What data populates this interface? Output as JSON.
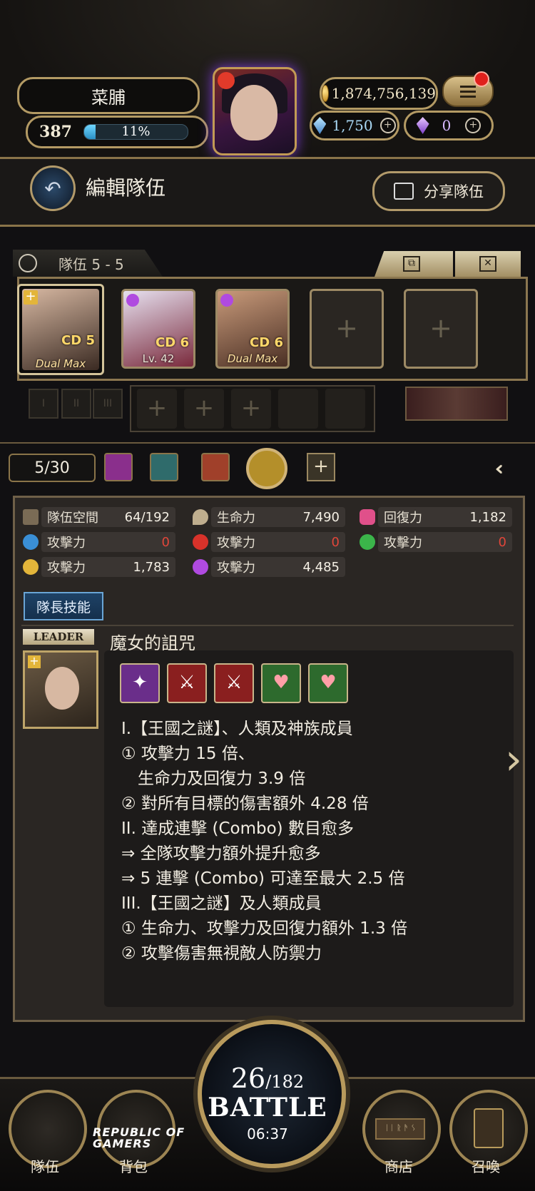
{
  "player": {
    "name": "菜脯",
    "level": "387",
    "xp_percent_text": "11%",
    "xp_fraction": 0.11
  },
  "currency": {
    "gold": "1,874,756,139",
    "diamonds": "1,750",
    "soul_crystals": "0"
  },
  "header": {
    "title": "編輯隊伍",
    "share_label": "分享隊伍"
  },
  "team": {
    "tab_label": "隊伍 5 - 5",
    "members": [
      {
        "cd": "CD 5",
        "sub": "Dual Max",
        "leader": true,
        "attr_color": "#e3b53a",
        "art": [
          "#d7b8a2",
          "#3a2a22"
        ]
      },
      {
        "cd": "CD 6",
        "sub": "Lv. 42",
        "leader": false,
        "attr_color": "#b04ae0",
        "art": [
          "#e6e0ef",
          "#7a2a3c"
        ]
      },
      {
        "cd": "CD 6",
        "sub": "Dual Max",
        "leader": false,
        "attr_color": "#b04ae0",
        "art": [
          "#c89a7a",
          "#4a2f24"
        ]
      }
    ]
  },
  "filter": {
    "count": "5/30",
    "attributes": [
      {
        "name": "dark-butterfly-filter-icon",
        "color": "#8a2f8c"
      },
      {
        "name": "water-head-filter-icon",
        "color": "#2f6b6b"
      },
      {
        "name": "fire-butterfly-filter-icon",
        "color": "#a0402a"
      },
      {
        "name": "light-head-filter-icon",
        "color": "#b48f2a"
      }
    ]
  },
  "stats": {
    "space_label": "隊伍空間",
    "space_value": "64/192",
    "hp_label": "生命力",
    "hp_value": "7,490",
    "recovery_label": "回復力",
    "recovery_value": "1,182",
    "water_atk_label": "攻擊力",
    "water_atk_value": "0",
    "fire_atk_label": "攻擊力",
    "fire_atk_value": "0",
    "earth_atk_label": "攻擊力",
    "earth_atk_value": "0",
    "light_atk_label": "攻擊力",
    "light_atk_value": "1,783",
    "dark_atk_label": "攻擊力",
    "dark_atk_value": "4,485"
  },
  "leader_skill": {
    "button_label": "隊長技能",
    "tag": "LEADER",
    "name": "魔女的詛咒",
    "lines": [
      "I.【王國之謎】、人類及神族成員",
      "① 攻擊力 15 倍、",
      "　生命力及回復力 3.9 倍",
      "② 對所有目標的傷害額外 4.28 倍",
      "II. 達成連擊 (Combo) 數目愈多",
      "⇒ 全隊攻擊力額外提升愈多",
      "⇒ 5 連擊 (Combo) 可達至最大 2.5 倍",
      "III.【王國之謎】及人類成員",
      "① 生命力、攻擊力及回復力額外 1.3 倍",
      "② 攻擊傷害無視敵人防禦力"
    ]
  },
  "battle": {
    "stamina_current": "26",
    "stamina_max": "/182",
    "label": "BATTLE",
    "timer": "06:37"
  },
  "nav": {
    "team": "隊伍",
    "bag": "背包",
    "shop": "商店",
    "summon": "召喚",
    "shop_sign": "ᛁᛁ ᚱ ᚫ ᛊ"
  },
  "watermark": {
    "line1": "REPUBLIC OF",
    "line2": "GAMERS"
  }
}
